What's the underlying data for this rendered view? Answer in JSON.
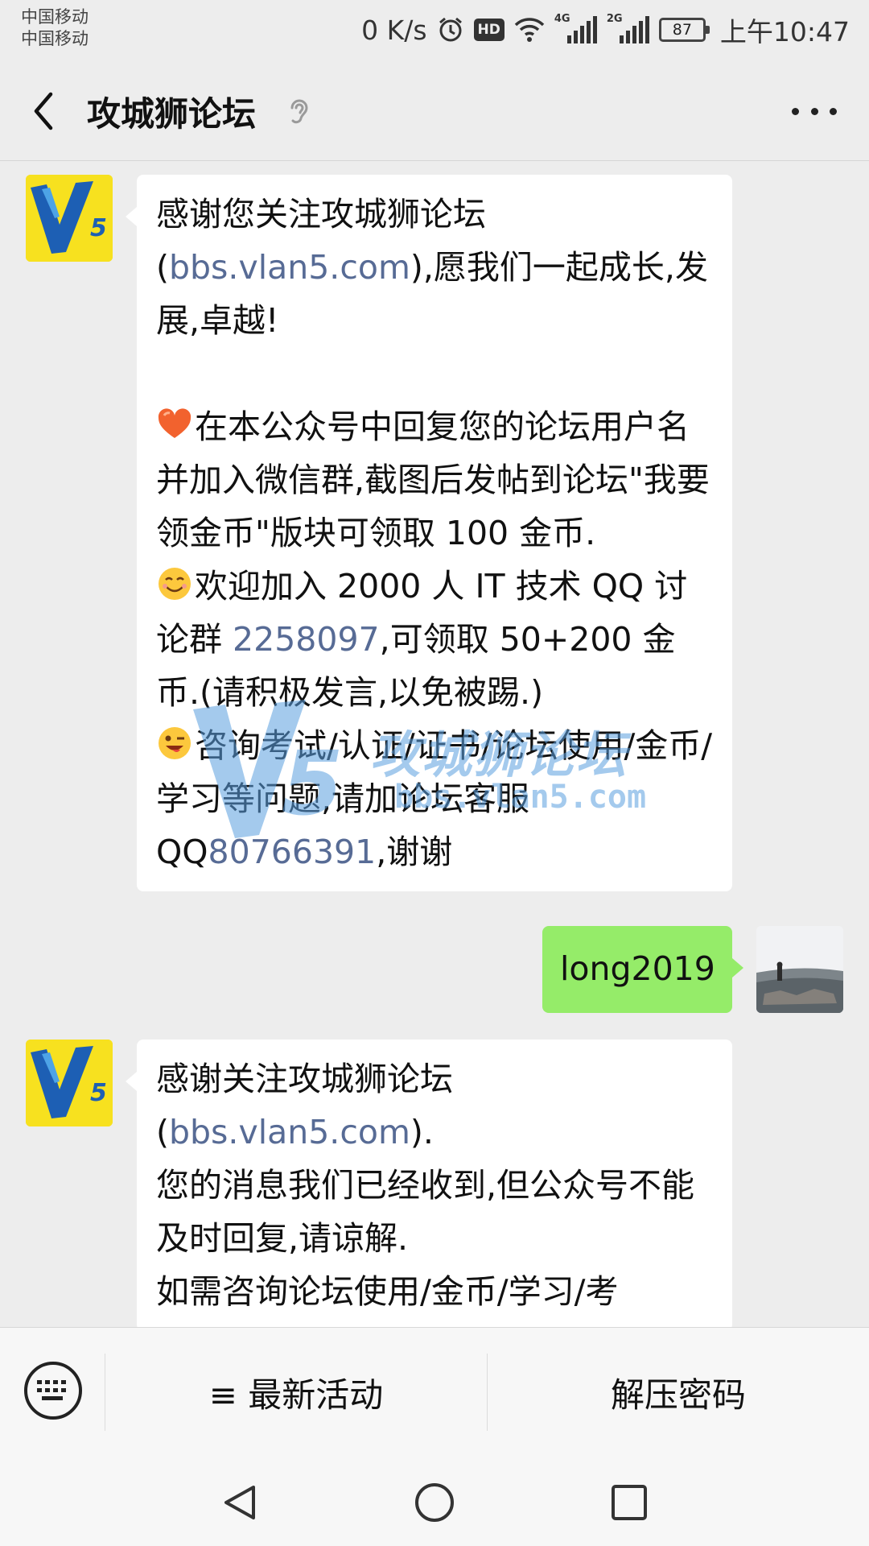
{
  "status_bar": {
    "carrier_1": "中国移动",
    "carrier_2": "中国移动",
    "net_speed": "0 K/s",
    "hd_badge": "HD",
    "signal_1_tag": "4G",
    "signal_2_tag": "2G",
    "battery": "87",
    "time": "上午10:47"
  },
  "header": {
    "title": "攻城狮论坛"
  },
  "messages": {
    "m1": {
      "p1_a": "感谢您关注攻城狮论坛(",
      "p1_link": "bbs.vlan5.com",
      "p1_b": "),愿我们一起成长,发展,卓越!",
      "p2": "在本公众号中回复您的论坛用户名并加入微信群,截图后发帖到论坛\"我要领金币\"版块可领取 100 金币.",
      "p3_a": "欢迎加入 2000 人 IT 技术 QQ 讨论群 ",
      "p3_link": "2258097",
      "p3_b": ",可领取 50+200 金币.(请积极发言,以免被踢.)",
      "p4_a": "咨询考试/认证/证书/论坛使用/金币/学习等问题,请加论坛客服QQ",
      "p4_link": "80766391",
      "p4_b": ",谢谢"
    },
    "m2": {
      "text": "long2019"
    },
    "m3": {
      "p1_a": "感谢关注攻城狮论坛(",
      "p1_link": "bbs.vlan5.com",
      "p1_b": ").",
      "p2": "您的消息我们已经收到,但公众号不能及时回复,请谅解.",
      "p3": "如需咨询论坛使用/金币/学习/考"
    }
  },
  "watermark": {
    "name": "攻城狮论坛",
    "url": "bbs.vlan5.com"
  },
  "menu": {
    "item1": "≡ 最新活动",
    "item2": "解压密码"
  },
  "colors": {
    "link": "#576b95",
    "sent_bubble": "#95ec69",
    "background": "#ededed"
  },
  "icons": [
    "back-arrow-icon",
    "ear-icon",
    "more-dots-icon",
    "heart-emoji-icon",
    "smile-emoji-icon",
    "wink-emoji-icon",
    "keyboard-icon",
    "nav-back-icon",
    "nav-home-icon",
    "nav-recents-icon"
  ]
}
